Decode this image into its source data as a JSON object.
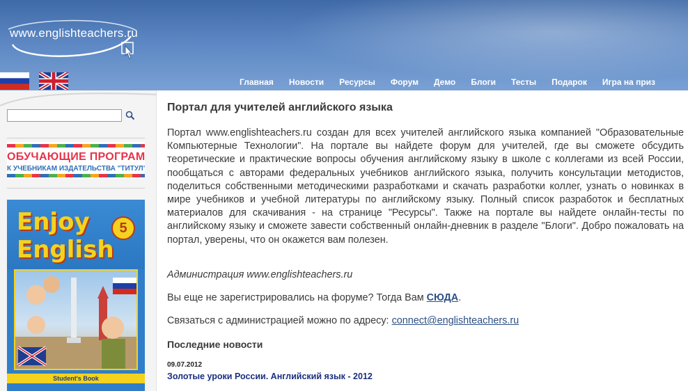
{
  "header": {
    "logo_text": "www.englishteachers.ru"
  },
  "languages": [
    {
      "name": "Русский"
    },
    {
      "name": "English"
    }
  ],
  "nav": {
    "items": [
      "Главная",
      "Новости",
      "Ресурсы",
      "Форум",
      "Демо",
      "Блоги",
      "Тесты",
      "Подарок",
      "Игра на приз"
    ]
  },
  "sidebar": {
    "search": {
      "value": "",
      "placeholder": ""
    },
    "banner1": {
      "line1": "ОБУЧАЮЩИЕ ПРОГРАММЫ",
      "line2": "К УЧЕБНИКАМ ИЗДАТЕЛЬСТВА \"ТИТУЛ\""
    },
    "book": {
      "title1": "Enjoy",
      "title2": "English",
      "number": "5",
      "label": "Student's Book"
    }
  },
  "main": {
    "title": "Портал для учителей английского языка",
    "intro": "Портал www.englishteachers.ru создан для всех учителей английского языка компанией \"Образовательные Компьютерные Технологии\". На портале вы найдете форум для учителей, где вы сможете обсудить теоретические и практические вопросы обучения английскому языку в школе с коллегами из всей России, пообщаться с авторами федеральных учебников английского языка, получить консультации методистов, поделиться собственными методическими разработками и скачать разработки коллег, узнать о новинках в мире учебников и учебной литературы по английскому языку. Полный список разработок и бесплатных материалов для скачивания - на странице \"Ресурсы\". Также на портале вы найдете онлайн-тесты по английскому языку и сможете завести собственный онлайн-дневник в разделе \"Блоги\". Добро пожаловать на портал, уверены, что он окажется вам полезен.",
    "admin": "Администрация www.englishteachers.ru",
    "register_text": "Вы еще не зарегистрировались на форуме? Тогда Вам ",
    "register_link": "СЮДА",
    "register_end": ".",
    "contact_text": "Связаться с администрацией можно по адресу: ",
    "contact_email": "connect@englishteachers.ru",
    "news_heading": "Последние новости",
    "news": [
      {
        "date": "09.07.2012",
        "title": "Золотые уроки России. Английский язык - 2012"
      }
    ]
  },
  "colors": {
    "header_blue": "#3f6aa8",
    "link": "#2c4f86",
    "news_link": "#1b2f80",
    "banner_red": "#e8334a",
    "book_yellow": "#f5d21d"
  }
}
